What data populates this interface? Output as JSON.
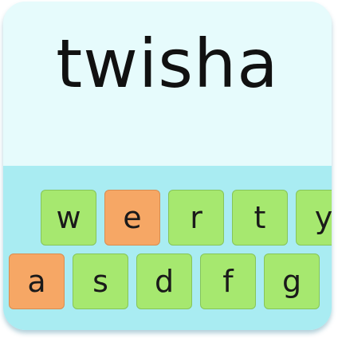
{
  "word": "twisha",
  "keyboard": {
    "row1": [
      {
        "label": "w",
        "highlighted": false
      },
      {
        "label": "e",
        "highlighted": true
      },
      {
        "label": "r",
        "highlighted": false
      },
      {
        "label": "t",
        "highlighted": false
      },
      {
        "label": "y",
        "highlighted": false
      }
    ],
    "row2": [
      {
        "label": "a",
        "highlighted": true
      },
      {
        "label": "s",
        "highlighted": false
      },
      {
        "label": "d",
        "highlighted": false
      },
      {
        "label": "f",
        "highlighted": false
      },
      {
        "label": "g",
        "highlighted": false
      }
    ]
  },
  "colors": {
    "panel": "#e6fbfc",
    "keyboard_bg": "#a9ecf2",
    "key": "#a6e86f",
    "key_highlight": "#f6a765"
  }
}
